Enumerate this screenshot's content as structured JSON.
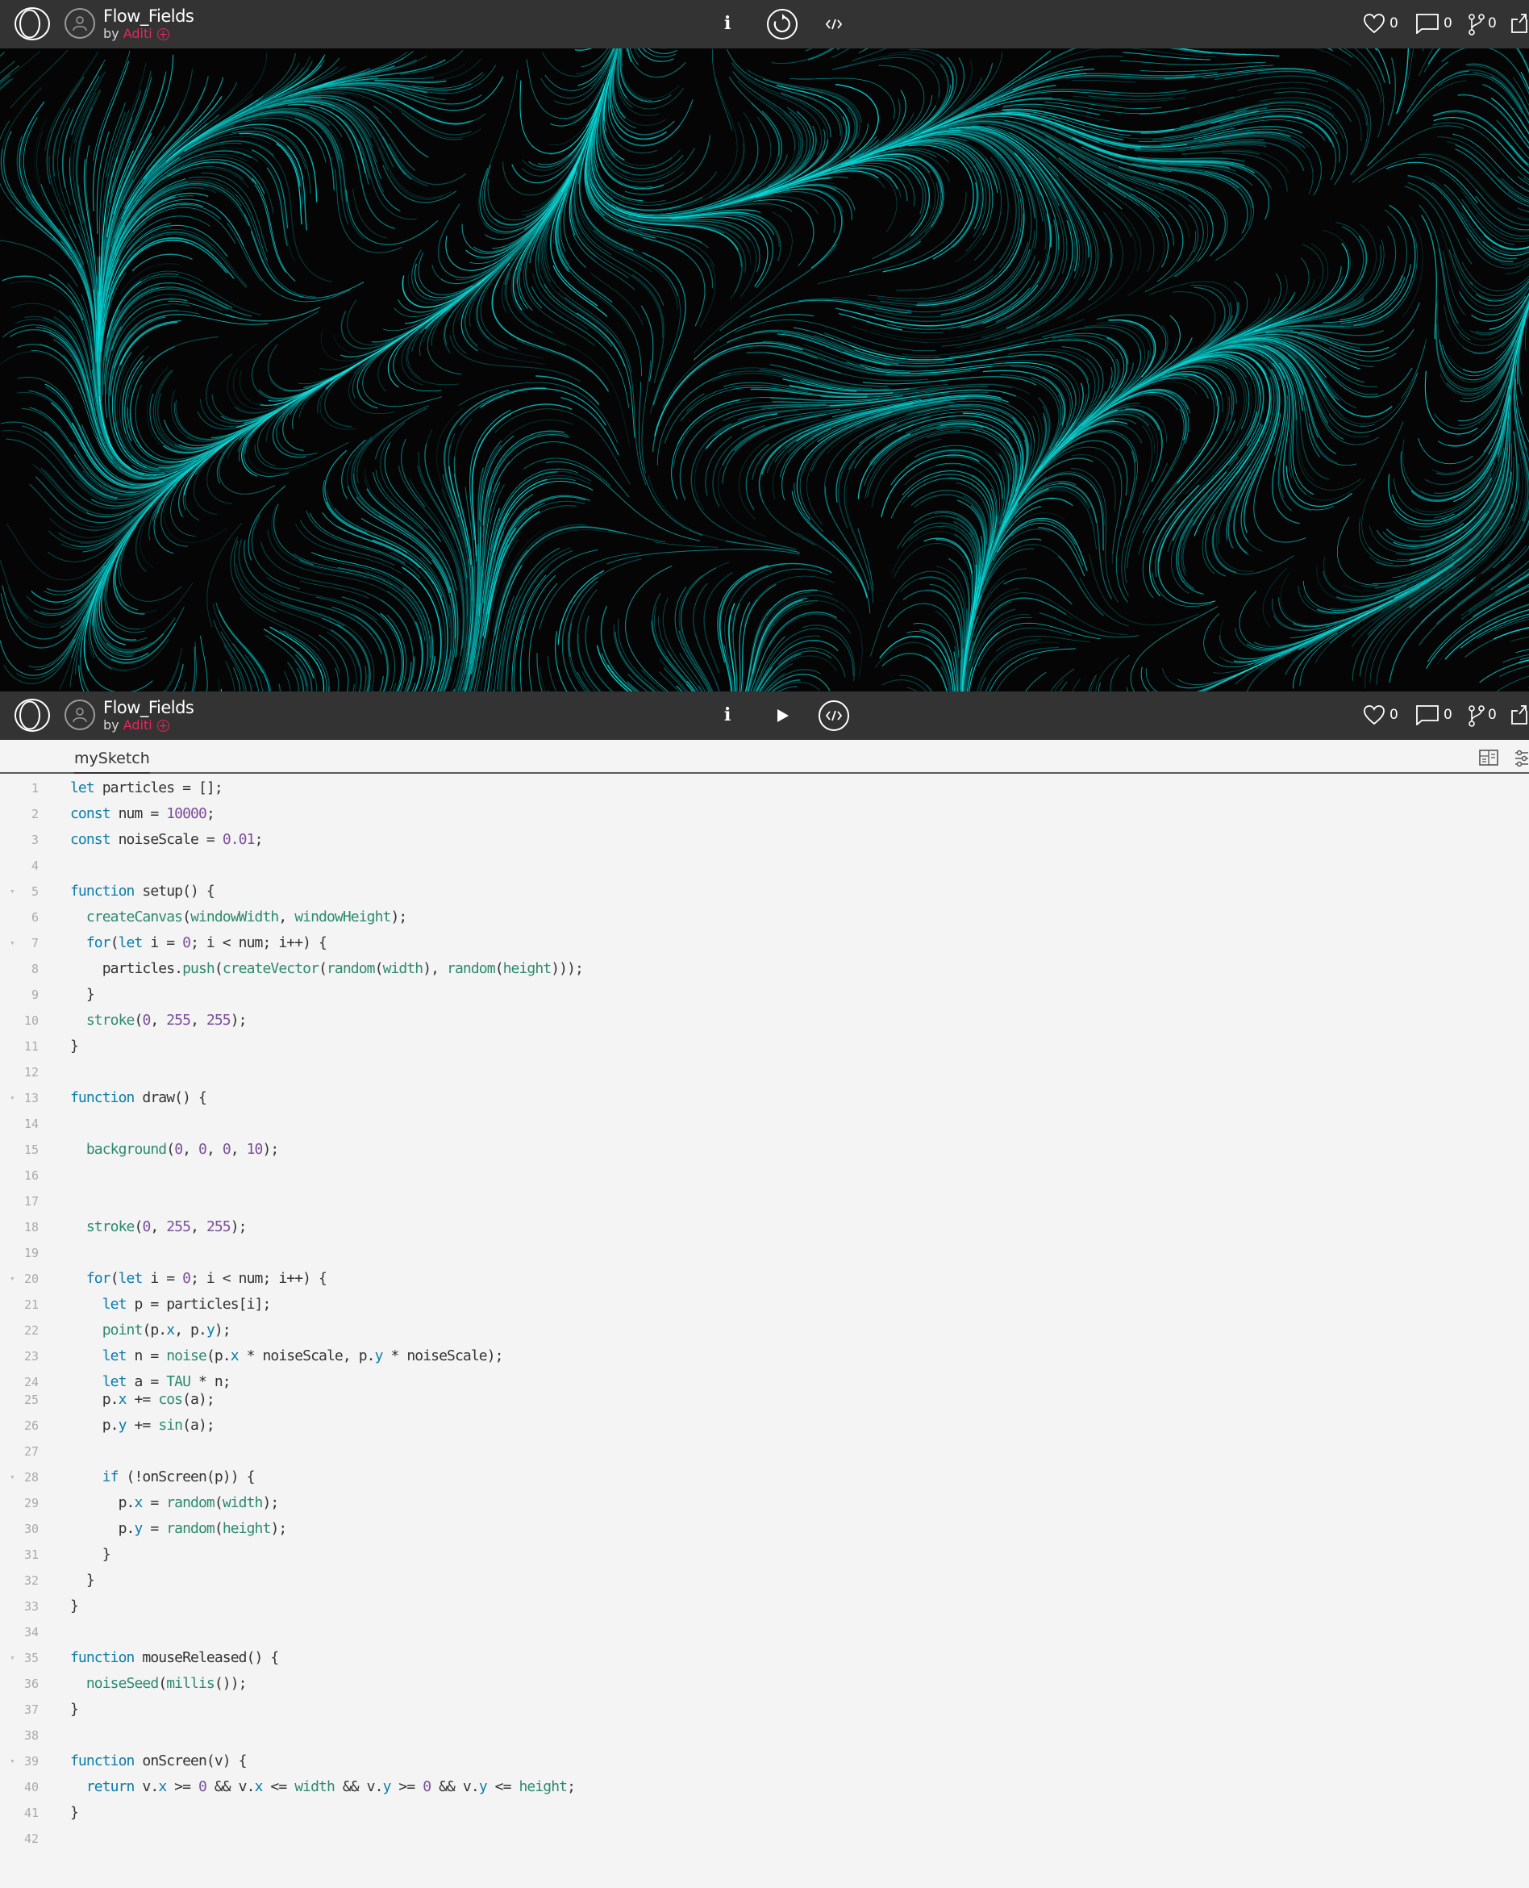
{
  "colors": {
    "bar": "#333333",
    "accent": "#ed225d",
    "flow": "#00ffff",
    "canvas_bg": "#050505"
  },
  "sketch": {
    "title": "Flow_Fields",
    "by": "by",
    "author": "Aditi",
    "follow_icon": "plus-circle-icon"
  },
  "toolbar": {
    "info_label": "i",
    "restart_icon": "restart-icon",
    "play_icon": "play-icon",
    "code_icon": "code-icon",
    "likes": "0",
    "comments": "0",
    "forks": "0"
  },
  "editor": {
    "tab_label": "mySketch",
    "lines": [
      {
        "n": "1",
        "f": "",
        "h": "<span class=kw>let</span> particles = [];"
      },
      {
        "n": "2",
        "f": "",
        "h": "<span class=kw>const</span> num = <span class=nm>10000</span>;"
      },
      {
        "n": "3",
        "f": "",
        "h": "<span class=kw>const</span> noiseScale = <span class=nm>0.01</span>;"
      },
      {
        "n": "4",
        "f": "",
        "h": ""
      },
      {
        "n": "5",
        "f": "▾",
        "h": "<span class=kw>function</span> setup() {"
      },
      {
        "n": "6",
        "f": "",
        "h": "  <span class=call>createCanvas</span>(<span class=call>windowWidth</span>, <span class=call>windowHeight</span>);"
      },
      {
        "n": "7",
        "f": "▾",
        "h": "  <span class=kw>for</span>(<span class=kw>let</span> i = <span class=nm>0</span>; i &lt; num; i++) {"
      },
      {
        "n": "8",
        "f": "",
        "h": "    particles.<span class=call>push</span>(<span class=call>createVector</span>(<span class=call>random</span>(<span class=call>width</span>), <span class=call>random</span>(<span class=call>height</span>)));"
      },
      {
        "n": "9",
        "f": "",
        "h": "  }"
      },
      {
        "n": "10",
        "f": "",
        "h": "  <span class=call>stroke</span>(<span class=nm>0</span>, <span class=nm>255</span>, <span class=nm>255</span>);"
      },
      {
        "n": "11",
        "f": "",
        "h": "}"
      },
      {
        "n": "12",
        "f": "",
        "h": ""
      },
      {
        "n": "13",
        "f": "▾",
        "h": "<span class=kw>function</span> draw() {"
      },
      {
        "n": "14",
        "f": "",
        "h": ""
      },
      {
        "n": "15",
        "f": "",
        "h": "  <span class=call>background</span>(<span class=nm>0</span>, <span class=nm>0</span>, <span class=nm>0</span>, <span class=nm>10</span>);"
      },
      {
        "n": "16",
        "f": "",
        "h": ""
      },
      {
        "n": "17",
        "f": "",
        "h": ""
      },
      {
        "n": "18",
        "f": "",
        "h": "  <span class=call>stroke</span>(<span class=nm>0</span>, <span class=nm>255</span>, <span class=nm>255</span>);"
      },
      {
        "n": "19",
        "f": "",
        "h": ""
      },
      {
        "n": "20",
        "f": "▾",
        "h": "  <span class=kw>for</span>(<span class=kw>let</span> i = <span class=nm>0</span>; i &lt; num; i++) {"
      },
      {
        "n": "21",
        "f": "",
        "h": "    <span class=kw>let</span> p = particles[i];"
      },
      {
        "n": "22",
        "f": "",
        "h": "    <span class=call>point</span>(p.<span class=pr>x</span>, p.<span class=pr>y</span>);"
      },
      {
        "n": "23",
        "f": "",
        "h": "    <span class=kw>let</span> n = <span class=call>noise</span>(p.<span class=pr>x</span> * noiseScale, p.<span class=pr>y</span> * noiseScale);"
      },
      {
        "n": "24",
        "f": "",
        "h": "    <span class=kw>let</span> a = <span class=call>TAU</span> * n;"
      },
      {
        "n": "25",
        "f": "",
        "h": "    p.<span class=pr>x</span> += <span class=call>cos</span>(a);"
      },
      {
        "n": "26",
        "f": "",
        "h": "    p.<span class=pr>y</span> += <span class=call>sin</span>(a);"
      },
      {
        "n": "27",
        "f": "",
        "h": ""
      },
      {
        "n": "28",
        "f": "▾",
        "h": "    <span class=kw>if</span> (!onScreen(p)) {"
      },
      {
        "n": "29",
        "f": "",
        "h": "      p.<span class=pr>x</span> = <span class=call>random</span>(<span class=call>width</span>);"
      },
      {
        "n": "30",
        "f": "",
        "h": "      p.<span class=pr>y</span> = <span class=call>random</span>(<span class=call>height</span>);"
      },
      {
        "n": "31",
        "f": "",
        "h": "    }"
      },
      {
        "n": "32",
        "f": "",
        "h": "  }"
      },
      {
        "n": "33",
        "f": "",
        "h": "}"
      },
      {
        "n": "34",
        "f": "",
        "h": ""
      },
      {
        "n": "35",
        "f": "▾",
        "h": "<span class=kw>function</span> mouseReleased() {"
      },
      {
        "n": "36",
        "f": "",
        "h": "  <span class=call>noiseSeed</span>(<span class=call>millis</span>());"
      },
      {
        "n": "37",
        "f": "",
        "h": "}"
      },
      {
        "n": "38",
        "f": "",
        "h": ""
      },
      {
        "n": "39",
        "f": "▾",
        "h": "<span class=kw>function</span> onScreen(v) {"
      },
      {
        "n": "40",
        "f": "",
        "h": "  <span class=kw>return</span> v.<span class=pr>x</span> &gt;= <span class=nm>0</span> &amp;&amp; v.<span class=pr>x</span> &lt;= <span class=call>width</span> &amp;&amp; v.<span class=pr>y</span> &gt;= <span class=nm>0</span> &amp;&amp; v.<span class=pr>y</span> &lt;= <span class=call>height</span>;"
      },
      {
        "n": "41",
        "f": "",
        "h": "}"
      },
      {
        "n": "42",
        "f": "",
        "h": ""
      }
    ]
  }
}
